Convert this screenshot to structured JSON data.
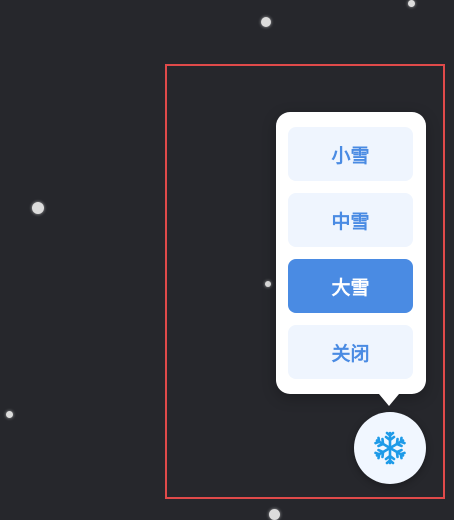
{
  "snow_menu": {
    "options": [
      {
        "label": "小雪",
        "selected": false
      },
      {
        "label": "中雪",
        "selected": false
      },
      {
        "label": "大雪",
        "selected": true
      },
      {
        "label": "关闭",
        "selected": false
      }
    ]
  },
  "fab": {
    "icon": "snowflake-icon"
  },
  "colors": {
    "background": "#26272c",
    "accent": "#4a8be3",
    "option_bg": "#eff5fe",
    "highlight_border": "#e04a4a",
    "snowflake_icon": "#1e9be8"
  }
}
